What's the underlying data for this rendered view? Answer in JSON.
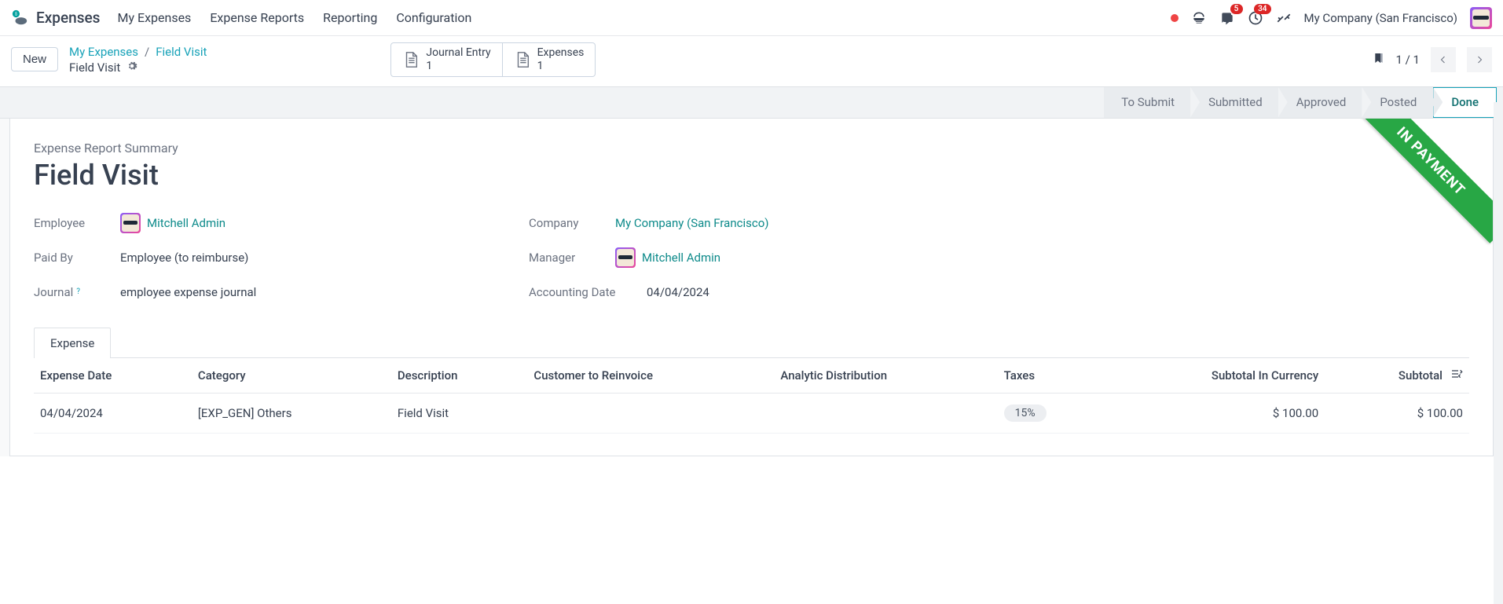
{
  "nav": {
    "app_title": "Expenses",
    "items": [
      "My Expenses",
      "Expense Reports",
      "Reporting",
      "Configuration"
    ],
    "messages_badge": "5",
    "activities_badge": "34",
    "company": "My Company (San Francisco)"
  },
  "cp": {
    "new_label": "New",
    "breadcrumb": [
      "My Expenses",
      "Field Visit"
    ],
    "title": "Field Visit",
    "stat_buttons": [
      {
        "label": "Journal Entry",
        "value": "1"
      },
      {
        "label": "Expenses",
        "value": "1"
      }
    ],
    "pager": "1 / 1"
  },
  "statusbar": {
    "steps": [
      "To Submit",
      "Submitted",
      "Approved",
      "Posted",
      "Done"
    ],
    "active": "Done"
  },
  "record": {
    "ribbon": "IN PAYMENT",
    "summary_label": "Expense Report Summary",
    "title": "Field Visit",
    "fields": {
      "employee_label": "Employee",
      "employee_value": "Mitchell Admin",
      "paidby_label": "Paid By",
      "paidby_value": "Employee (to reimburse)",
      "journal_label": "Journal",
      "journal_value": "employee expense journal",
      "company_label": "Company",
      "company_value": "My Company (San Francisco)",
      "manager_label": "Manager",
      "manager_value": "Mitchell Admin",
      "accdate_label": "Accounting Date",
      "accdate_value": "04/04/2024"
    }
  },
  "expense_tab": {
    "tab_label": "Expense",
    "columns": {
      "date": "Expense Date",
      "category": "Category",
      "description": "Description",
      "customer": "Customer to Reinvoice",
      "analytic": "Analytic Distribution",
      "taxes": "Taxes",
      "subtotal_cur": "Subtotal In Currency",
      "subtotal": "Subtotal"
    },
    "rows": [
      {
        "date": "04/04/2024",
        "category": "[EXP_GEN] Others",
        "description": "Field Visit",
        "customer": "",
        "analytic": "",
        "taxes": "15%",
        "subtotal_cur": "$ 100.00",
        "subtotal": "$ 100.00"
      }
    ]
  }
}
